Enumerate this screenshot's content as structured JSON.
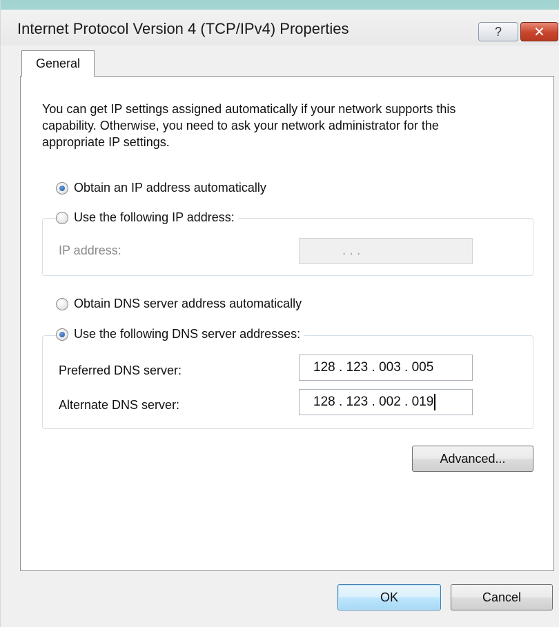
{
  "window": {
    "title": "Internet Protocol Version 4 (TCP/IPv4) Properties",
    "help_glyph": "?",
    "close_glyph": "✕"
  },
  "tabs": [
    {
      "label": "General",
      "selected": true
    }
  ],
  "intro_text": "You can get IP settings assigned automatically if your network supports this capability. Otherwise, you need to ask your network administrator for the appropriate IP settings.",
  "ip_section": {
    "auto_label": "Obtain an IP address automatically",
    "auto_selected": true,
    "manual_label": "Use the following IP address:",
    "manual_selected": false,
    "ip_address_label": "IP address:",
    "ip_address_value": ".      .      ."
  },
  "dns_section": {
    "auto_label": "Obtain DNS server address automatically",
    "auto_selected": false,
    "manual_label": "Use the following DNS server addresses:",
    "manual_selected": true,
    "preferred_label": "Preferred DNS server:",
    "preferred_value": "128 . 123 . 003 . 005",
    "alternate_label": "Alternate DNS server:",
    "alternate_value": "128 . 123 . 002 . 019"
  },
  "buttons": {
    "advanced": "Advanced...",
    "ok": "OK",
    "cancel": "Cancel"
  },
  "colors": {
    "close_button": "#c8452c",
    "default_button_border": "#3c7fb1",
    "radio_dot": "#1f4f9a"
  }
}
